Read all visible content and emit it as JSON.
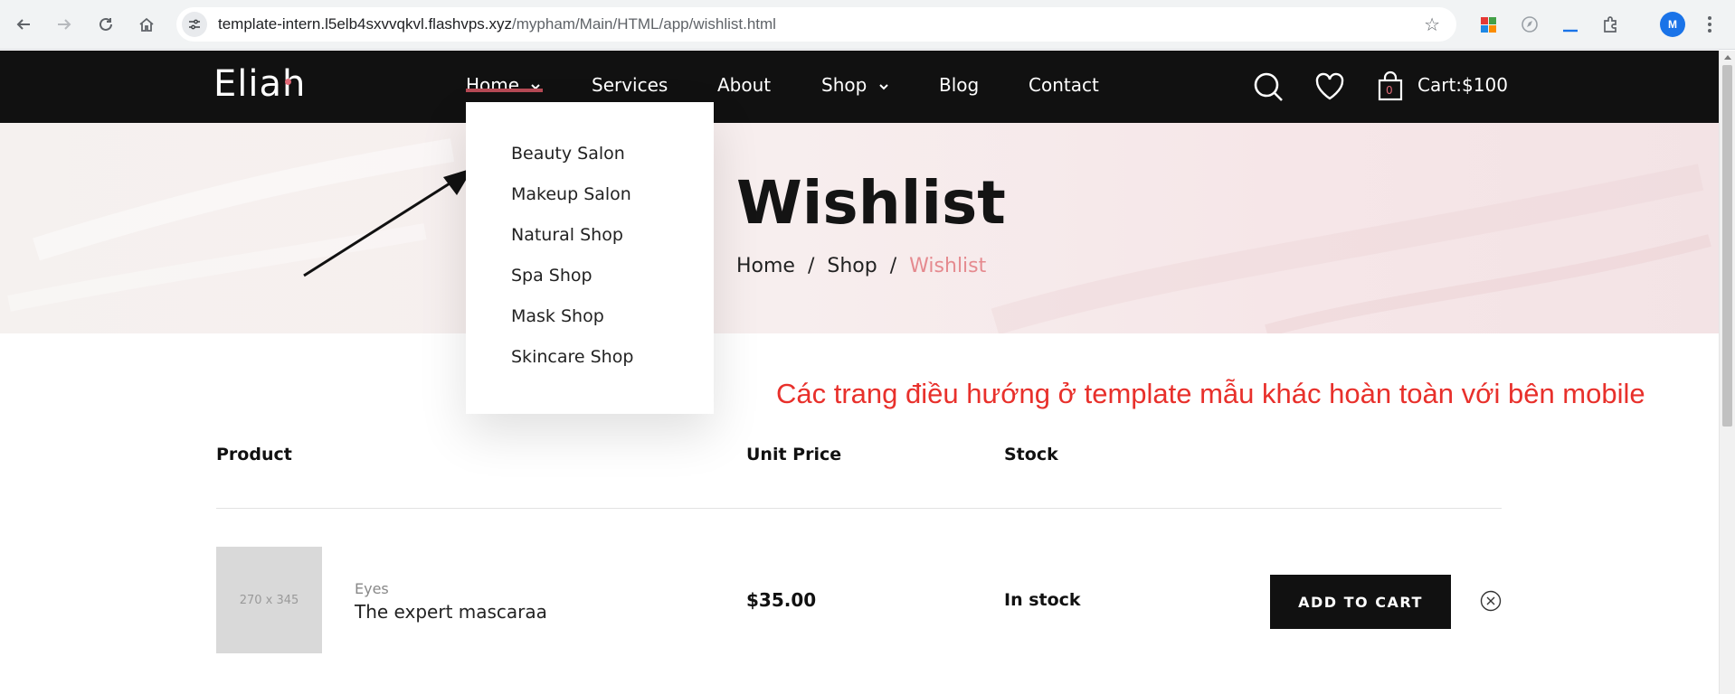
{
  "browser": {
    "url_host": "template-intern.l5elb4sxvvqkvl.flashvps.xyz",
    "url_path": "/mypham/Main/HTML/app/wishlist.html",
    "profile_initials": "M"
  },
  "header": {
    "logo": "Eliah",
    "nav": [
      {
        "label": "Home"
      },
      {
        "label": "Services"
      },
      {
        "label": "About"
      },
      {
        "label": "Shop"
      },
      {
        "label": "Blog"
      },
      {
        "label": "Contact"
      }
    ],
    "cart_count": "0",
    "cart_label": "Cart:$100"
  },
  "dropdown": {
    "items": [
      "Beauty Salon",
      "Makeup Salon",
      "Natural Shop",
      "Spa Shop",
      "Mask Shop",
      "Skincare Shop"
    ]
  },
  "hero": {
    "title": "Wishlist",
    "breadcrumb": [
      "Home",
      "/",
      "Shop",
      "/",
      "Wishlist"
    ]
  },
  "annotation": {
    "note": "Các trang điều hướng ở template mẫu khác hoàn toàn với bên mobile"
  },
  "table": {
    "headers": {
      "product": "Product",
      "unit_price": "Unit Price",
      "stock": "Stock"
    },
    "rows": [
      {
        "thumb_placeholder": "270 x 345",
        "category": "Eyes",
        "name": "The expert mascaraa",
        "price": "$35.00",
        "stock": "In stock",
        "action": "ADD TO CART"
      }
    ]
  },
  "colors": {
    "header_bg": "#111111",
    "accent_pink": "#e58a8f",
    "note_red": "#e8302b",
    "button_bg": "#111111"
  },
  "icons": [
    "back-icon",
    "forward-icon",
    "reload-icon",
    "home-icon",
    "site-settings-icon",
    "bookmark-star-icon",
    "extension-icon",
    "puzzle-icon",
    "search-icon",
    "heart-icon",
    "shopping-bag-icon",
    "chevron-down-icon",
    "close-circle-icon"
  ]
}
